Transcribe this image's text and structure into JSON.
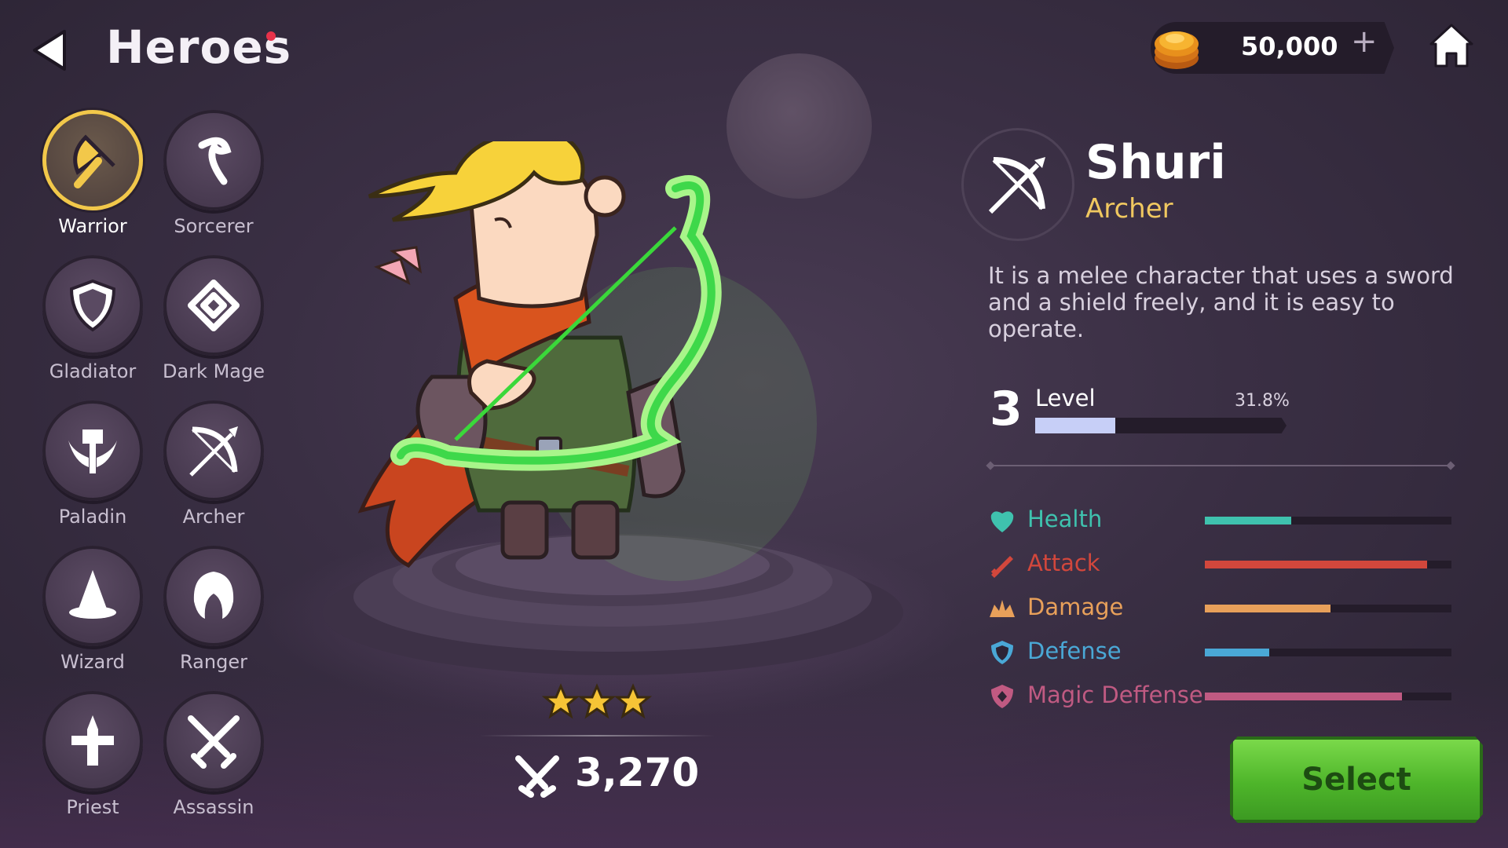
{
  "header": {
    "title": "Heroes",
    "currency_value": "50,000",
    "currency_plus": "+"
  },
  "classes": [
    {
      "label": "Warrior",
      "icon": "axe-icon",
      "selected": true
    },
    {
      "label": "Sorcerer",
      "icon": "staff-icon",
      "selected": false
    },
    {
      "label": "Gladiator",
      "icon": "shield-icon",
      "selected": false
    },
    {
      "label": "Dark Mage",
      "icon": "dark-rune-icon",
      "selected": false
    },
    {
      "label": "Paladin",
      "icon": "winged-hammer-icon",
      "selected": false
    },
    {
      "label": "Archer",
      "icon": "bow-icon",
      "selected": false
    },
    {
      "label": "Wizard",
      "icon": "wizard-hat-icon",
      "selected": false
    },
    {
      "label": "Ranger",
      "icon": "hood-icon",
      "selected": false
    },
    {
      "label": "Priest",
      "icon": "holy-cross-icon",
      "selected": false
    },
    {
      "label": "Assassin",
      "icon": "crossed-daggers-icon",
      "selected": false
    }
  ],
  "hero": {
    "stars": 3,
    "power": "3,270",
    "name": "Shuri",
    "class": "Archer",
    "description": "It is a melee character that uses a sword and a shield freely, and it is easy to operate.",
    "level_number": "3",
    "level_label": "Level",
    "level_percent": "31.8%",
    "level_progress": 0.318
  },
  "stats": [
    {
      "label": "Health",
      "value": 0.35,
      "color": "#3fc2ae",
      "icon": "heart-icon"
    },
    {
      "label": "Attack",
      "value": 0.9,
      "color": "#d2473c",
      "icon": "sword-icon"
    },
    {
      "label": "Damage",
      "value": 0.51,
      "color": "#e8a05a",
      "icon": "burst-icon"
    },
    {
      "label": "Defense",
      "value": 0.26,
      "color": "#4aa8d6",
      "icon": "shield-icon"
    },
    {
      "label": "Magic Deffense",
      "value": 0.8,
      "color": "#c05a82",
      "icon": "magic-shield-icon"
    }
  ],
  "actions": {
    "select_label": "Select"
  },
  "colors": {
    "accent_gold": "#f2c84a",
    "select_green": "#5cc232",
    "class_text": "#f0c860"
  }
}
